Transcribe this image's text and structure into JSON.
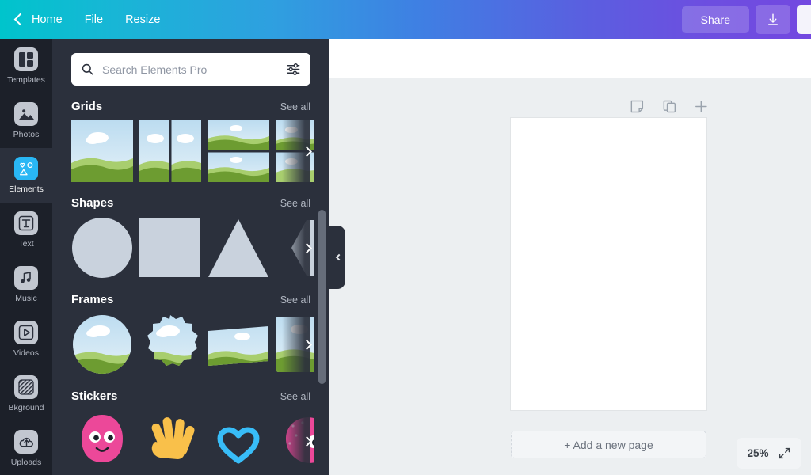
{
  "header": {
    "home_label": "Home",
    "menu": [
      {
        "label": "File"
      },
      {
        "label": "Resize"
      }
    ],
    "share_label": "Share",
    "download_icon": "download-icon",
    "back_icon": "chevron-left-icon",
    "gradient_start": "#00c4cc",
    "gradient_end": "#7348e0"
  },
  "sidebar": {
    "items": [
      {
        "label": "Templates",
        "icon": "templates-icon",
        "active": false
      },
      {
        "label": "Photos",
        "icon": "photos-icon",
        "active": false
      },
      {
        "label": "Elements",
        "icon": "elements-icon",
        "active": true
      },
      {
        "label": "Text",
        "icon": "text-icon",
        "active": false
      },
      {
        "label": "Music",
        "icon": "music-icon",
        "active": false
      },
      {
        "label": "Videos",
        "icon": "videos-icon",
        "active": false
      },
      {
        "label": "Bkground",
        "icon": "background-icon",
        "active": false
      },
      {
        "label": "Uploads",
        "icon": "uploads-icon",
        "active": false
      }
    ],
    "active_color": "#29b7f5",
    "background": "#1c2029"
  },
  "panel": {
    "background": "#2b303c",
    "search": {
      "placeholder": "Search Elements Pro",
      "search_icon": "search-icon",
      "filter_icon": "filter-sliders-icon"
    },
    "see_all_label": "See all",
    "sections": [
      {
        "title": "Grids",
        "kind": "grid"
      },
      {
        "title": "Shapes",
        "kind": "shape"
      },
      {
        "title": "Frames",
        "kind": "frame"
      },
      {
        "title": "Stickers",
        "kind": "sticker"
      }
    ],
    "shape_color": "#c9d2dd",
    "sticker_colors": {
      "blob": "#ec4899",
      "hand": "#f9c04a",
      "heart": "#38bdf8"
    },
    "collapse_icon": "chevron-left-icon",
    "next_icon": "chevron-right-icon"
  },
  "canvas": {
    "background": "#eceff1",
    "page_tools": [
      {
        "icon": "note-page-icon"
      },
      {
        "icon": "duplicate-page-icon"
      },
      {
        "icon": "add-page-plus-icon"
      }
    ],
    "add_page_label": "+ Add a new page",
    "zoom_level": "25%",
    "fullscreen_icon": "expand-arrows-icon"
  }
}
